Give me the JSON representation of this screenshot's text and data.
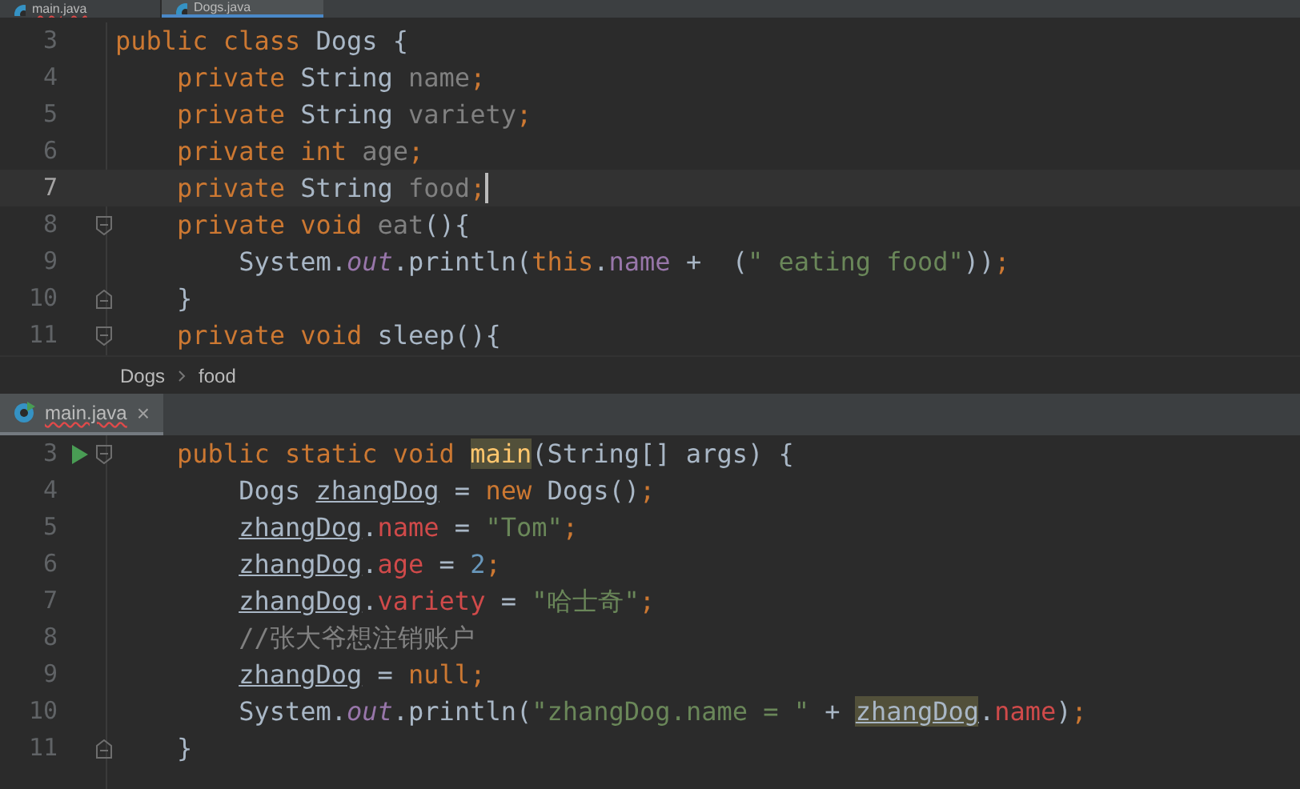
{
  "top_tabs": [
    {
      "label": "main.java",
      "selected": false,
      "error": true
    },
    {
      "label": "Dogs.java",
      "selected": true,
      "error": false
    }
  ],
  "top_editor": {
    "lines": [
      {
        "number": "3",
        "current": false,
        "run": false,
        "caret": false,
        "tokens": [
          {
            "kind": "kw",
            "t": "public class "
          },
          {
            "kind": "plain",
            "t": "Dogs {"
          }
        ]
      },
      {
        "number": "4",
        "current": false,
        "run": false,
        "caret": false,
        "tokens": [
          {
            "kind": "kw",
            "t": "    private "
          },
          {
            "kind": "plain",
            "t": "String "
          },
          {
            "kind": "unused",
            "t": "name"
          },
          {
            "kind": "kw",
            "t": ";"
          }
        ]
      },
      {
        "number": "5",
        "current": false,
        "run": false,
        "caret": false,
        "tokens": [
          {
            "kind": "kw",
            "t": "    private "
          },
          {
            "kind": "plain",
            "t": "String "
          },
          {
            "kind": "unused",
            "t": "variety"
          },
          {
            "kind": "kw",
            "t": ";"
          }
        ]
      },
      {
        "number": "6",
        "current": false,
        "run": false,
        "caret": false,
        "tokens": [
          {
            "kind": "kw",
            "t": "    private int "
          },
          {
            "kind": "unused",
            "t": "age"
          },
          {
            "kind": "kw",
            "t": ";"
          }
        ]
      },
      {
        "number": "7",
        "current": true,
        "run": false,
        "caret": true,
        "tokens": [
          {
            "kind": "kw",
            "t": "    private "
          },
          {
            "kind": "plain",
            "t": "String "
          },
          {
            "kind": "unused",
            "t": "food"
          },
          {
            "kind": "kw",
            "t": ";"
          }
        ]
      },
      {
        "number": "8",
        "current": false,
        "run": false,
        "caret": false,
        "fold_start": true,
        "tokens": [
          {
            "kind": "kw",
            "t": "    private void "
          },
          {
            "kind": "unused",
            "t": "eat"
          },
          {
            "kind": "plain",
            "t": "(){"
          }
        ]
      },
      {
        "number": "9",
        "current": false,
        "run": false,
        "caret": false,
        "tokens": [
          {
            "kind": "plain",
            "t": "        System."
          },
          {
            "kind": "static",
            "t": "out"
          },
          {
            "kind": "plain",
            "t": ".println("
          },
          {
            "kind": "kw",
            "t": "this"
          },
          {
            "kind": "plain",
            "t": "."
          },
          {
            "kind": "field",
            "t": "name"
          },
          {
            "kind": "plain",
            "t": " +  ("
          },
          {
            "kind": "str",
            "t": "\" eating food\""
          },
          {
            "kind": "plain",
            "t": "))"
          },
          {
            "kind": "kw",
            "t": ";"
          }
        ]
      },
      {
        "number": "10",
        "current": false,
        "run": false,
        "caret": false,
        "fold_end": true,
        "tokens": [
          {
            "kind": "plain",
            "t": "    }"
          }
        ]
      },
      {
        "number": "11",
        "current": false,
        "run": false,
        "caret": false,
        "fold_start": true,
        "tokens": [
          {
            "kind": "kw",
            "t": "    private void "
          },
          {
            "kind": "plain",
            "t": "sleep(){"
          }
        ]
      }
    ]
  },
  "breadcrumb": [
    "Dogs",
    "food"
  ],
  "bottom_tab": {
    "label": "main.java",
    "selected": true,
    "error": true,
    "close": "×"
  },
  "bottom_editor": {
    "lines": [
      {
        "number": "3",
        "current": false,
        "run": true,
        "caret": false,
        "fold_start": true,
        "tokens": [
          {
            "kind": "kw",
            "t": "    public static void "
          },
          {
            "kind": "mark",
            "t": "main"
          },
          {
            "kind": "plain",
            "t": "(String[] args) {"
          }
        ]
      },
      {
        "number": "4",
        "current": false,
        "run": false,
        "caret": false,
        "tokens": [
          {
            "kind": "plain",
            "t": "        Dogs "
          },
          {
            "kind": "var",
            "t": "zhangDog"
          },
          {
            "kind": "plain",
            "t": " = "
          },
          {
            "kind": "kw",
            "t": "new "
          },
          {
            "kind": "plain",
            "t": "Dogs()"
          },
          {
            "kind": "kw",
            "t": ";"
          }
        ]
      },
      {
        "number": "5",
        "current": false,
        "run": false,
        "caret": false,
        "tokens": [
          {
            "kind": "var",
            "t": "        zhangDog"
          },
          {
            "kind": "plain",
            "t": "."
          },
          {
            "kind": "err",
            "t": "name"
          },
          {
            "kind": "plain",
            "t": " = "
          },
          {
            "kind": "str",
            "t": "\"Tom\""
          },
          {
            "kind": "kw",
            "t": ";"
          }
        ]
      },
      {
        "number": "6",
        "current": false,
        "run": false,
        "caret": false,
        "tokens": [
          {
            "kind": "var",
            "t": "        zhangDog"
          },
          {
            "kind": "plain",
            "t": "."
          },
          {
            "kind": "err",
            "t": "age"
          },
          {
            "kind": "plain",
            "t": " = "
          },
          {
            "kind": "num",
            "t": "2"
          },
          {
            "kind": "kw",
            "t": ";"
          }
        ]
      },
      {
        "number": "7",
        "current": false,
        "run": false,
        "caret": false,
        "tokens": [
          {
            "kind": "var",
            "t": "        zhangDog"
          },
          {
            "kind": "plain",
            "t": "."
          },
          {
            "kind": "err",
            "t": "variety"
          },
          {
            "kind": "plain",
            "t": " = "
          },
          {
            "kind": "str",
            "t": "\"哈士奇\""
          },
          {
            "kind": "kw",
            "t": ";"
          }
        ]
      },
      {
        "number": "8",
        "current": false,
        "run": false,
        "caret": false,
        "tokens": [
          {
            "kind": "comment",
            "t": "        //张大爷想注销账户"
          }
        ]
      },
      {
        "number": "9",
        "current": false,
        "run": false,
        "caret": false,
        "tokens": [
          {
            "kind": "var",
            "t": "        zhangDog"
          },
          {
            "kind": "plain",
            "t": " = "
          },
          {
            "kind": "kw",
            "t": "null;"
          }
        ]
      },
      {
        "number": "10",
        "current": false,
        "run": false,
        "caret": false,
        "tokens": [
          {
            "kind": "plain",
            "t": "        System."
          },
          {
            "kind": "static",
            "t": "out"
          },
          {
            "kind": "plain",
            "t": ".println("
          },
          {
            "kind": "str",
            "t": "\"zhangDog.name = \""
          },
          {
            "kind": "plain",
            "t": " + "
          },
          {
            "kind": "varmark",
            "t": "zhangDog"
          },
          {
            "kind": "plain",
            "t": "."
          },
          {
            "kind": "err",
            "t": "name"
          },
          {
            "kind": "plain",
            "t": ")"
          },
          {
            "kind": "kw",
            "t": ";"
          }
        ]
      },
      {
        "number": "11",
        "current": false,
        "run": false,
        "caret": false,
        "fold_end": true,
        "tokens": [
          {
            "kind": "plain",
            "t": "    }"
          }
        ]
      }
    ]
  }
}
